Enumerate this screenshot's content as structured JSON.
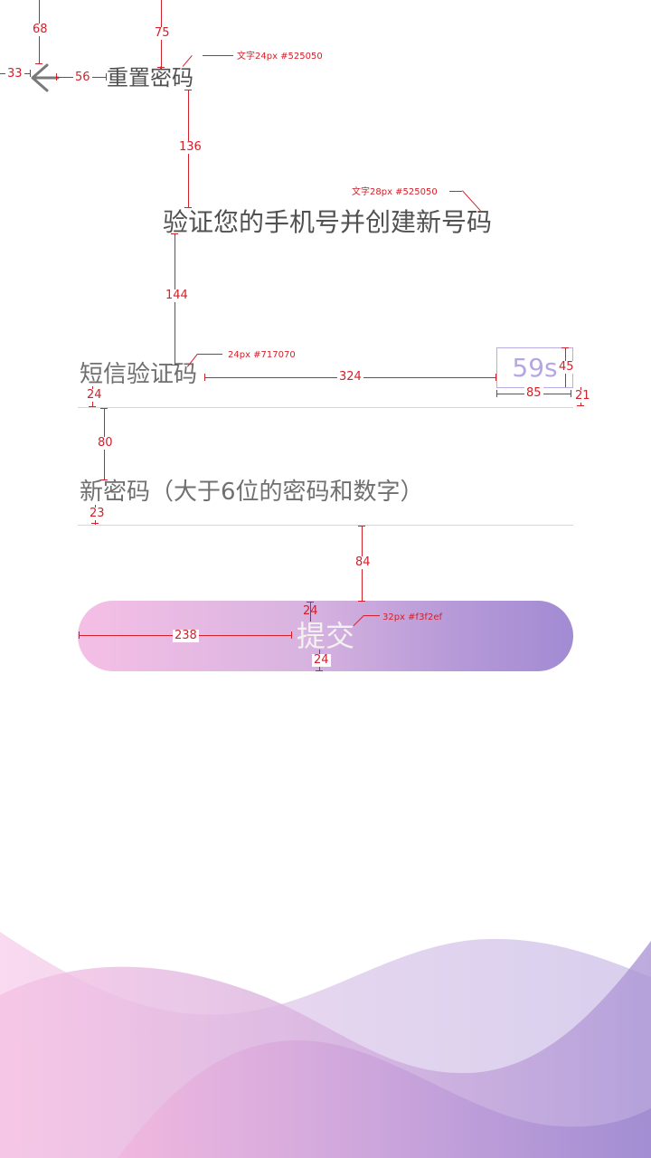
{
  "header": {
    "title": "重置密码",
    "back_icon": "arrow-left-icon"
  },
  "main": {
    "subtitle": "验证您的手机号并创建新号码",
    "fields": [
      {
        "label": "短信验证码",
        "timer": "59s"
      },
      {
        "label": "新密码（大于6位的密码和数字）"
      }
    ],
    "submit_label": "提交"
  },
  "annotations": {
    "m68": "68",
    "m75": "75",
    "m33": "33",
    "m56": "56",
    "m136": "136",
    "m144": "144",
    "m24a": "24",
    "m324": "324",
    "m45": "45",
    "m85": "85",
    "m21": "21",
    "m80": "80",
    "m23": "23",
    "m84": "84",
    "m238": "238",
    "m24b": "24",
    "m24c": "24",
    "note_title": "文字24px   #525050",
    "note_subtitle": "文字28px   #525050",
    "note_label": "24px   #717070",
    "note_button": "32px   #f3f2ef"
  },
  "colors": {
    "text_primary": "#525050",
    "text_secondary": "#717070",
    "button_text": "#f3f2ef",
    "accent": "#b6a6e3",
    "annotation": "#d3202b"
  }
}
